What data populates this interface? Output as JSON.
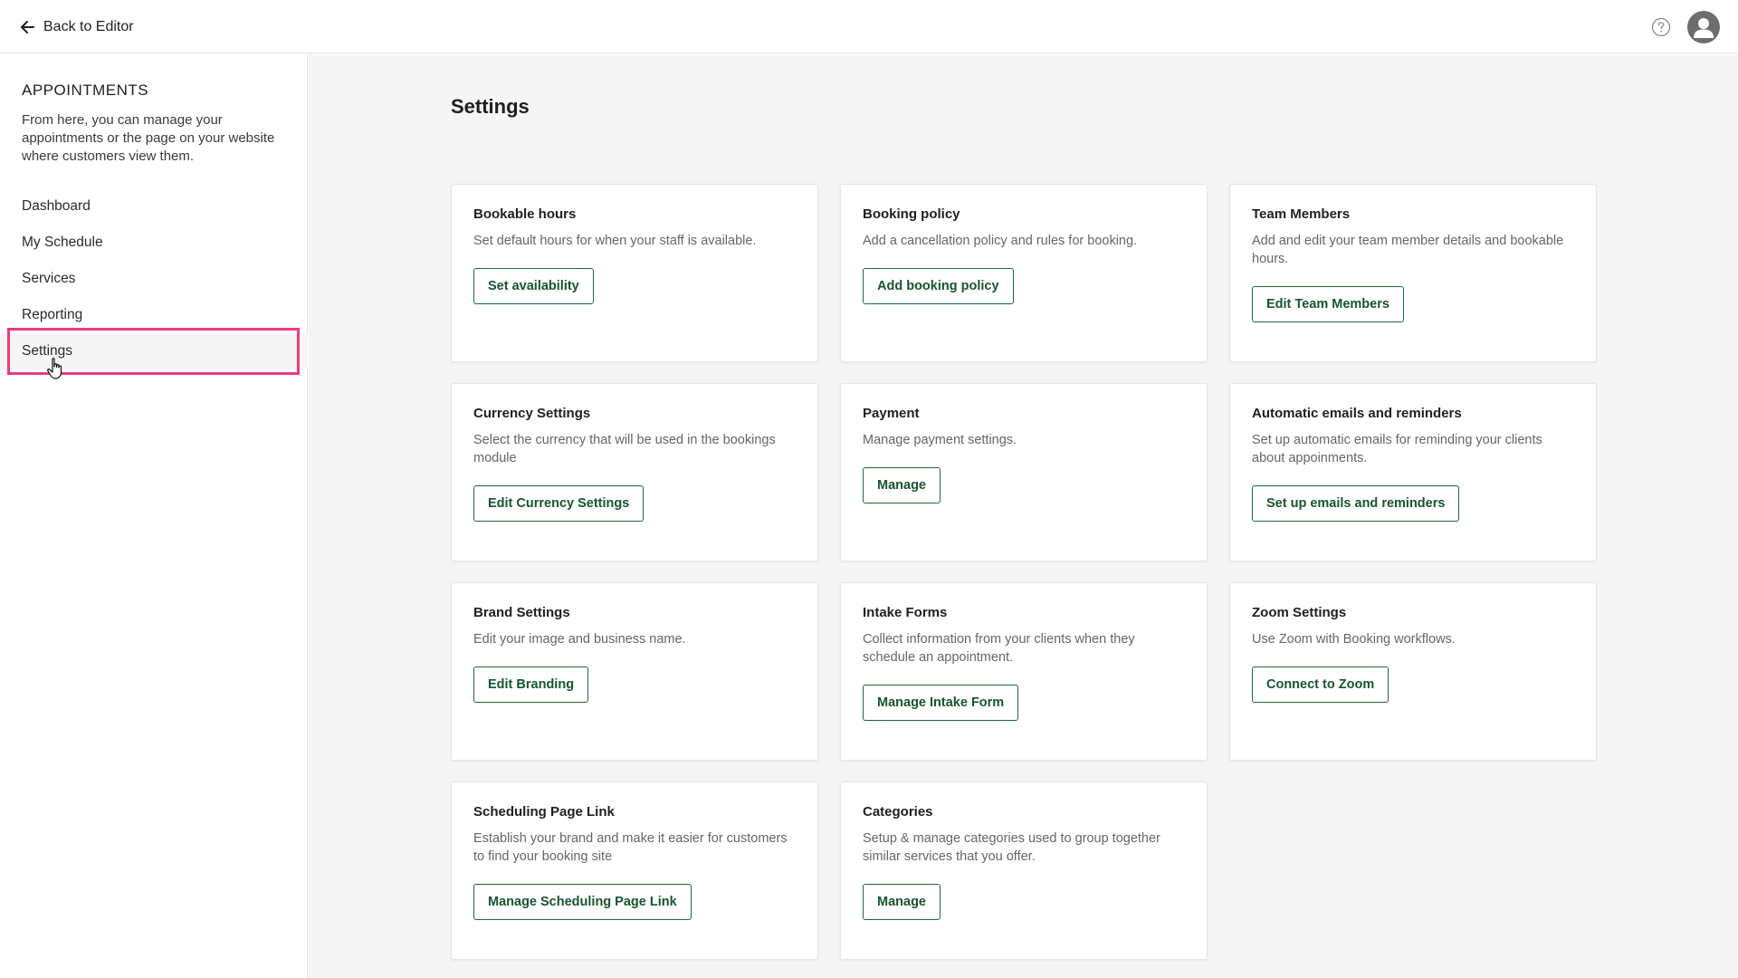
{
  "topbar": {
    "back_label": "Back to Editor",
    "back_icon": "arrow-left-icon",
    "help_icon": "help-circle-icon",
    "avatar_icon": "user-avatar-icon"
  },
  "sidebar": {
    "title": "APPOINTMENTS",
    "description": "From here, you can manage your appointments or the page on your website where customers view them.",
    "items": [
      {
        "label": "Dashboard"
      },
      {
        "label": "My Schedule"
      },
      {
        "label": "Services"
      },
      {
        "label": "Reporting"
      },
      {
        "label": "Settings"
      }
    ],
    "active_index": 4
  },
  "main": {
    "title": "Settings",
    "cards": [
      {
        "title": "Bookable hours",
        "description": "Set default hours for when your staff is available.",
        "button": "Set availability"
      },
      {
        "title": "Booking policy",
        "description": "Add a cancellation policy and rules for booking.",
        "button": "Add booking policy"
      },
      {
        "title": "Team Members",
        "description": "Add and edit your team member details and bookable hours.",
        "button": "Edit Team Members"
      },
      {
        "title": "Currency Settings",
        "description": "Select the currency that will be used in the bookings module",
        "button": "Edit Currency Settings"
      },
      {
        "title": "Payment",
        "description": "Manage payment settings.",
        "button": "Manage"
      },
      {
        "title": "Automatic emails and reminders",
        "description": "Set up automatic emails for reminding your clients about appoinments.",
        "button": "Set up emails and reminders"
      },
      {
        "title": "Brand Settings",
        "description": "Edit your image and business name.",
        "button": "Edit Branding"
      },
      {
        "title": "Intake Forms",
        "description": "Collect information from your clients when they schedule an appointment.",
        "button": "Manage Intake Form"
      },
      {
        "title": "Zoom Settings",
        "description": "Use Zoom with Booking workflows.",
        "button": "Connect to Zoom"
      },
      {
        "title": "Scheduling Page Link",
        "description": "Establish your brand and make it easier for customers to find your booking site",
        "button": "Manage Scheduling Page Link"
      },
      {
        "title": "Categories",
        "description": "Setup & manage categories used to group together similar services that you offer.",
        "button": "Manage"
      }
    ]
  },
  "colors": {
    "accent_green": "#17552f",
    "highlight_pink": "#ec3b7f",
    "background": "#f5f5f5"
  }
}
